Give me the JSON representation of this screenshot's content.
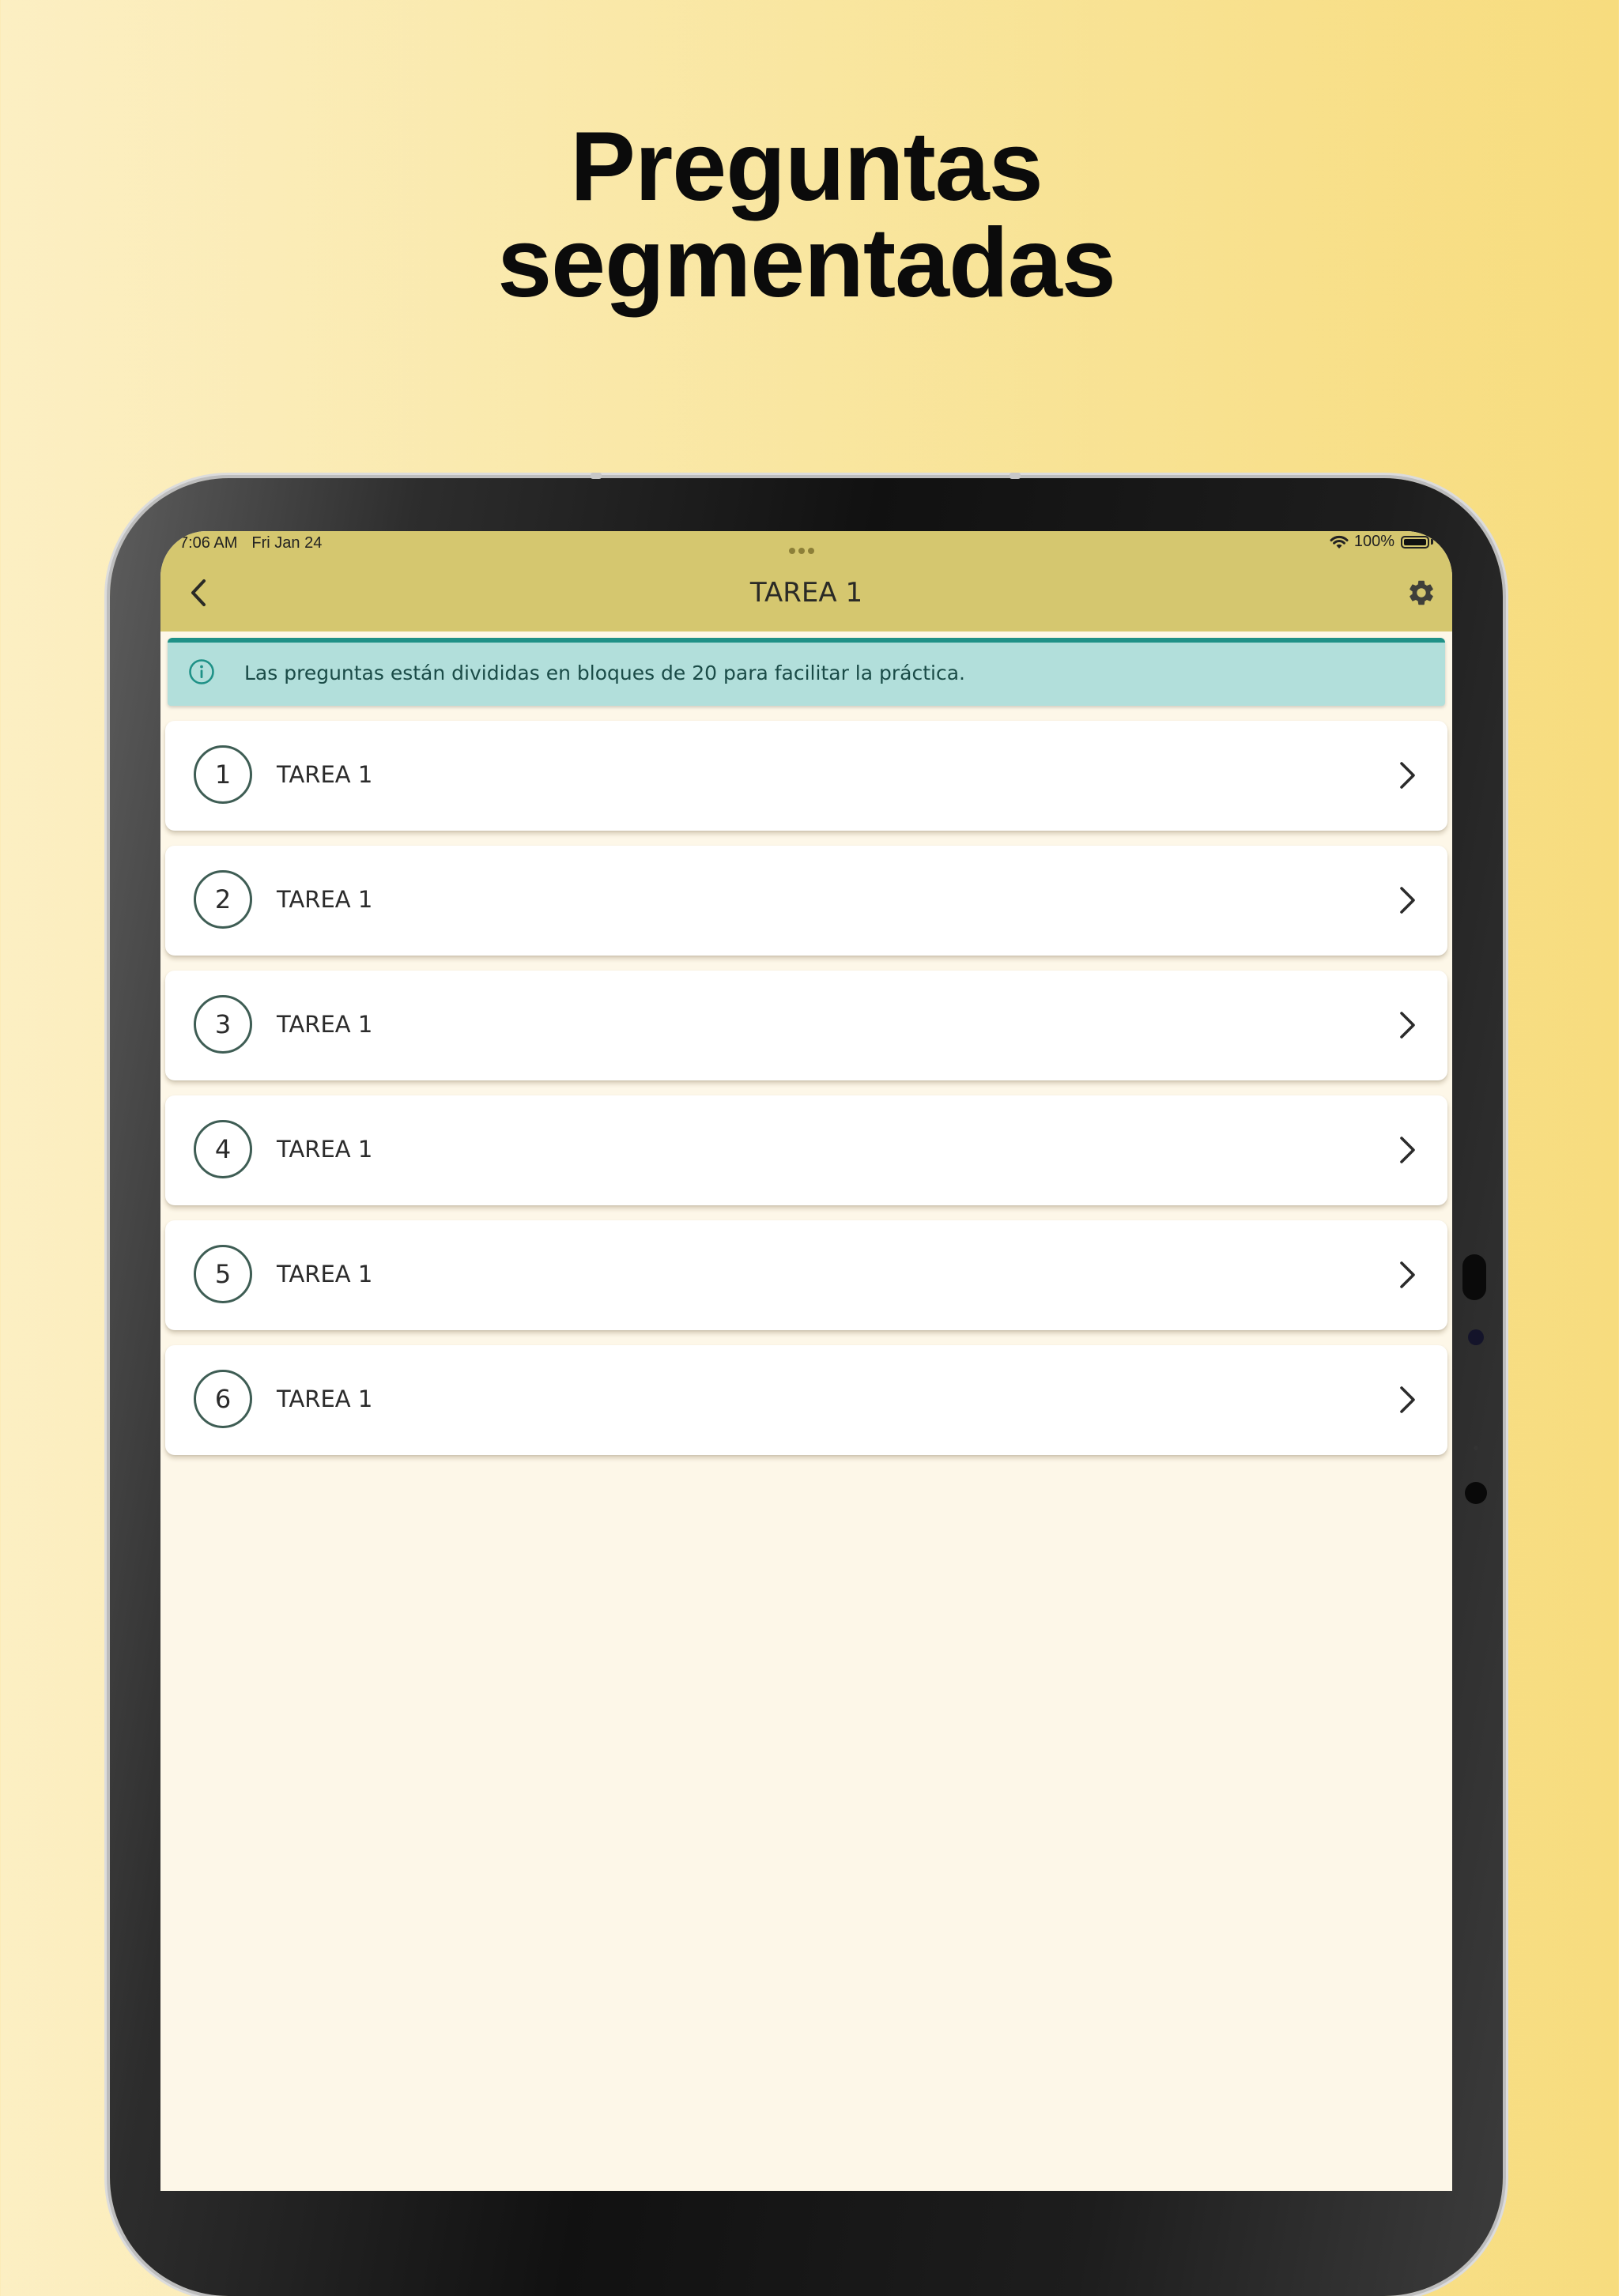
{
  "headline": {
    "line1": "Preguntas",
    "line2": "segmentadas"
  },
  "status_bar": {
    "time": "7:06 AM",
    "date": "Fri Jan 24",
    "battery": "100%"
  },
  "app_bar": {
    "title": "TAREA 1",
    "back_icon": "chevron-left-icon",
    "settings_icon": "gear-icon"
  },
  "info_banner": {
    "icon": "info-icon",
    "text": "Las preguntas están divididas en bloques de 20 para facilitar la práctica."
  },
  "blocks": [
    {
      "number": "1",
      "label": "TAREA 1"
    },
    {
      "number": "2",
      "label": "TAREA 1"
    },
    {
      "number": "3",
      "label": "TAREA 1"
    },
    {
      "number": "4",
      "label": "TAREA 1"
    },
    {
      "number": "5",
      "label": "TAREA 1"
    },
    {
      "number": "6",
      "label": "TAREA 1"
    }
  ],
  "colors": {
    "app_bar": "#d5c76f",
    "banner_bg": "#b2dfdb",
    "banner_accent": "#1f9187",
    "screen_bg": "#fdf7e8",
    "circle_border": "#3e5d54"
  }
}
